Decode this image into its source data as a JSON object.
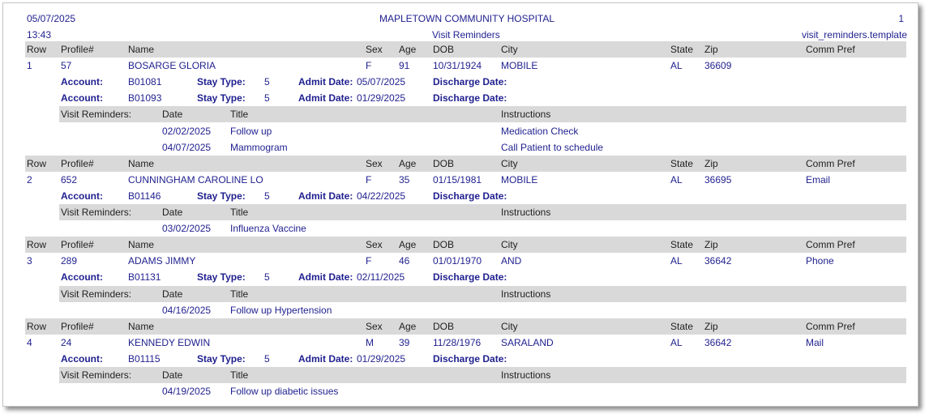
{
  "header": {
    "date": "05/07/2025",
    "time": "13:43",
    "hospital": "MAPLETOWN COMMUNITY HOSPITAL",
    "report_title": "Visit Reminders",
    "page_number": "1",
    "template": "visit_reminders.template"
  },
  "labels": {
    "row": "Row",
    "profile": "Profile#",
    "name": "Name",
    "sex": "Sex",
    "age": "Age",
    "dob": "DOB",
    "city": "City",
    "state": "State",
    "zip": "Zip",
    "comm_pref": "Comm Pref",
    "account": "Account:",
    "stay_type": "Stay Type:",
    "admit_date": "Admit Date:",
    "discharge_date": "Discharge Date:",
    "visit_reminders": "Visit Reminders:",
    "date": "Date",
    "title": "Title",
    "instructions": "Instructions"
  },
  "patients": [
    {
      "row": "1",
      "profile": "57",
      "name": "BOSARGE GLORIA",
      "sex": "F",
      "age": "91",
      "dob": "10/31/1924",
      "city": "MOBILE",
      "state": "AL",
      "zip": "36609",
      "comm_pref": "",
      "accounts": [
        {
          "account": "B01081",
          "stay_type": "5",
          "admit_date": "05/07/2025",
          "discharge_date": ""
        },
        {
          "account": "B01093",
          "stay_type": "5",
          "admit_date": "01/29/2025",
          "discharge_date": ""
        }
      ],
      "reminders": [
        {
          "date": "02/02/2025",
          "title": "Follow up",
          "instructions": "Medication Check"
        },
        {
          "date": "04/07/2025",
          "title": "Mammogram",
          "instructions": "Call Patient to schedule"
        }
      ]
    },
    {
      "row": "2",
      "profile": "652",
      "name": "CUNNINGHAM CAROLINE LO",
      "sex": "F",
      "age": "35",
      "dob": "01/15/1981",
      "city": "MOBILE",
      "state": "AL",
      "zip": "36695",
      "comm_pref": "Email",
      "accounts": [
        {
          "account": "B01146",
          "stay_type": "5",
          "admit_date": "04/22/2025",
          "discharge_date": ""
        }
      ],
      "reminders": [
        {
          "date": "03/02/2025",
          "title": "Influenza Vaccine",
          "instructions": ""
        }
      ]
    },
    {
      "row": "3",
      "profile": "289",
      "name": "ADAMS JIMMY",
      "sex": "F",
      "age": "46",
      "dob": "01/01/1970",
      "city": "AND",
      "state": "AL",
      "zip": "36642",
      "comm_pref": "Phone",
      "accounts": [
        {
          "account": "B01131",
          "stay_type": "5",
          "admit_date": "02/11/2025",
          "discharge_date": ""
        }
      ],
      "reminders": [
        {
          "date": "04/16/2025",
          "title": "Follow up Hypertension",
          "instructions": ""
        }
      ]
    },
    {
      "row": "4",
      "profile": "24",
      "name": "KENNEDY EDWIN",
      "sex": "M",
      "age": "39",
      "dob": "11/28/1976",
      "city": "SARALAND",
      "state": "AL",
      "zip": "36642",
      "comm_pref": "Mail",
      "accounts": [
        {
          "account": "B01115",
          "stay_type": "5",
          "admit_date": "01/29/2025",
          "discharge_date": ""
        }
      ],
      "reminders": [
        {
          "date": "04/19/2025",
          "title": "Follow up diabetic issues",
          "instructions": ""
        }
      ]
    }
  ]
}
